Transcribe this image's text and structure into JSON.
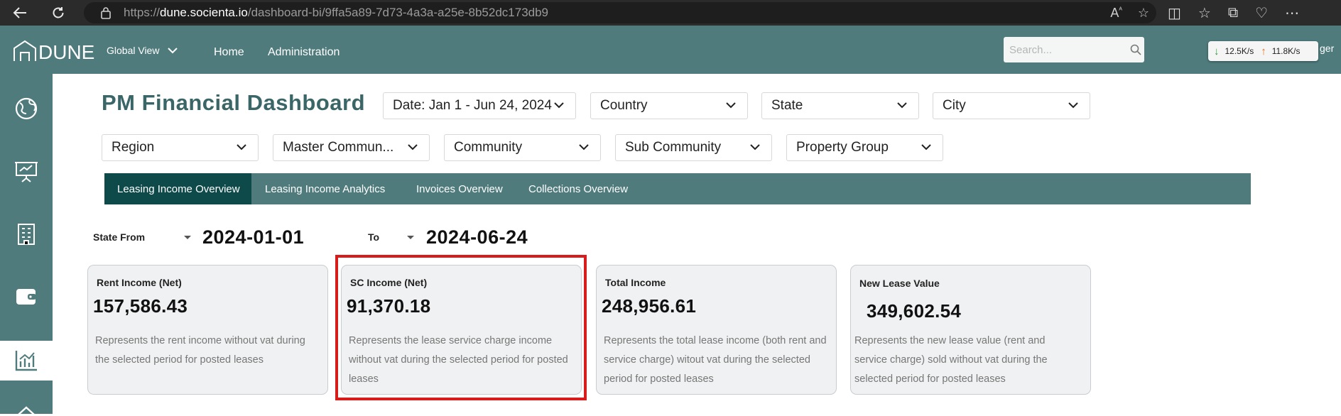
{
  "browser": {
    "url_prefix": "https://",
    "url_host": "dune.socienta.io",
    "url_path": "/dashboard-bi/9ffa5a89-7d73-4a3a-a25e-8b52dc173db9"
  },
  "header": {
    "logo_text": "DUNE",
    "global_view": "Global View",
    "nav": [
      "Home",
      "Administration"
    ],
    "search_placeholder": "Search...",
    "network": {
      "down": "12.5K/s",
      "up": "11.8K/s"
    },
    "user_clip": "ger"
  },
  "sidebar": {
    "icons": [
      "globe-icon",
      "presentation-icon",
      "building-icon",
      "wallet-icon",
      "chart-icon",
      "home-icon"
    ],
    "active_index": 4
  },
  "page": {
    "title": "PM Financial Dashboard"
  },
  "filters": {
    "date": "Date: Jan 1 - Jun 24, 2024",
    "country": "Country",
    "state": "State",
    "city": "City",
    "region": "Region",
    "master_community": "Master Commun...",
    "community": "Community",
    "sub_community": "Sub Community",
    "property_group": "Property Group"
  },
  "tabs": [
    {
      "label": "Leasing Income Overview",
      "active": true
    },
    {
      "label": "Leasing Income Analytics",
      "active": false
    },
    {
      "label": "Invoices Overview",
      "active": false
    },
    {
      "label": "Collections Overview",
      "active": false
    }
  ],
  "date_range": {
    "from_label": "State From",
    "from_value": "2024-01-01",
    "to_label": "To",
    "to_value": "2024-06-24"
  },
  "cards": [
    {
      "title": "Rent Income (Net)",
      "value": "157,586.43",
      "desc": "Represents the rent income without vat during the selected period for posted leases"
    },
    {
      "title": "SC Income (Net)",
      "value": "91,370.18",
      "desc": "Represents the lease service charge income without vat during the selected period for posted leases"
    },
    {
      "title": "Total Income",
      "value": "248,956.61",
      "desc": "Represents the total lease income (both rent and service charge) witout vat during the selected period for posted leases"
    },
    {
      "title": "New Lease Value",
      "value": "349,602.54",
      "desc": "Represents the new lease value (rent and service charge) sold without vat during the selected period for posted leases"
    }
  ],
  "colors": {
    "brand_teal": "#4f7b7d",
    "active_tab": "#0f4a4b",
    "highlight": "#d81b1b"
  }
}
